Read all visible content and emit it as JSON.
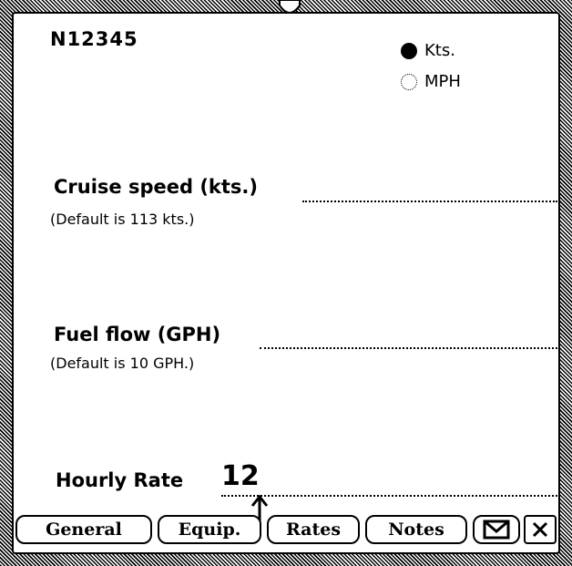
{
  "header": {
    "aircraft_id": "N12345"
  },
  "units": {
    "options": [
      {
        "label": "Kts.",
        "selected": true
      },
      {
        "label": "MPH",
        "selected": false
      }
    ]
  },
  "fields": {
    "cruise": {
      "label": "Cruise speed (kts.)",
      "hint": "(Default is 113 kts.)",
      "value": ""
    },
    "fuel": {
      "label": "Fuel flow (GPH)",
      "hint": "(Default is 10 GPH.)",
      "value": ""
    },
    "rate": {
      "label": "Hourly Rate",
      "value": "12"
    }
  },
  "tabs": [
    {
      "label": "General"
    },
    {
      "label": "Equip."
    },
    {
      "label": "Rates"
    },
    {
      "label": "Notes"
    }
  ],
  "icons": {
    "mail": "envelope-icon",
    "close": "close-icon"
  }
}
